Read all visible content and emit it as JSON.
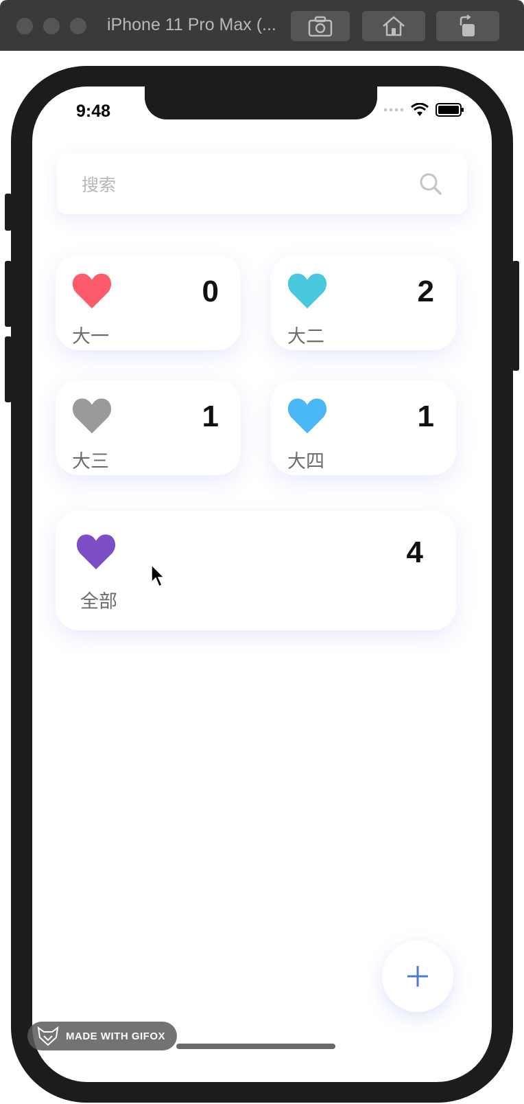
{
  "simulator": {
    "title": "iPhone 11 Pro Max (...",
    "buttons": [
      "screenshot-icon",
      "home-icon",
      "rotate-icon"
    ]
  },
  "status_bar": {
    "time": "9:48"
  },
  "search": {
    "placeholder": "搜索"
  },
  "categories": [
    {
      "label": "大一",
      "count": "0",
      "color": "#fb5b6b"
    },
    {
      "label": "大二",
      "count": "2",
      "color": "#4ac9de"
    },
    {
      "label": "大三",
      "count": "1",
      "color": "#9a9a9a"
    },
    {
      "label": "大四",
      "count": "1",
      "color": "#4ab8f5"
    }
  ],
  "all": {
    "label": "全部",
    "count": "4",
    "color": "#7b4ec6"
  },
  "fab": {
    "icon": "plus-icon",
    "color": "#4a7bd0"
  },
  "watermark": {
    "text": "MADE WITH GIFOX"
  }
}
